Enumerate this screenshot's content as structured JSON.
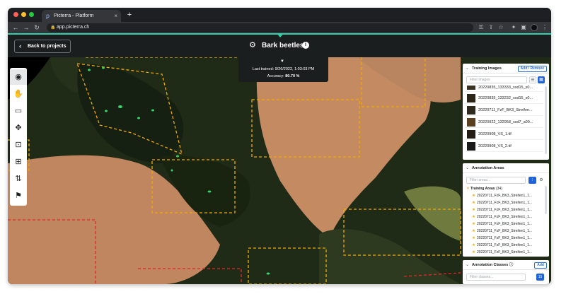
{
  "browser": {
    "tab_title": "Picterra - Platform",
    "tab_favicon": "picterra-logo-icon",
    "new_tab": "+",
    "close_tab": "×",
    "url": "app.picterra.ch",
    "nav": {
      "back": "←",
      "forward": "→",
      "reload": "↻"
    },
    "window_dots": [
      "#ff5f57",
      "#febc2e",
      "#28c840"
    ],
    "toolbar_icons": [
      "key-icon",
      "share-icon",
      "star-icon",
      "extension-icon",
      "sidebar-icon",
      "profile-avatar",
      "menu-icon"
    ]
  },
  "header": {
    "back_label": "Back to projects",
    "title": "Bark beetles",
    "accent": "#2fd1a8"
  },
  "training_status": {
    "last_trained": "Last trained: 9/26/2022, 1:03:03 PM",
    "accuracy_label": "Accuracy:",
    "accuracy_value": "80.70 %"
  },
  "tools": [
    {
      "name": "visibility",
      "icon": "eye-icon",
      "glyph": "◉"
    },
    {
      "name": "pan",
      "icon": "hand-icon",
      "glyph": "✋"
    },
    {
      "name": "rectangle",
      "icon": "rectangle-tool-icon",
      "glyph": "▭"
    },
    {
      "name": "move",
      "icon": "move-arrows-icon",
      "glyph": "✥"
    },
    {
      "name": "square-select",
      "icon": "square-select-icon",
      "glyph": "⊡"
    },
    {
      "name": "zoom-box",
      "icon": "zoom-box-icon",
      "glyph": "⊞"
    },
    {
      "name": "sort",
      "icon": "sort-arrows-icon",
      "glyph": "⇅"
    },
    {
      "name": "flag",
      "icon": "flag-icon",
      "glyph": "⚑"
    }
  ],
  "training_images": {
    "header": "Training Images",
    "add_remove": "Add / Remove",
    "filter_placeholder": "Filter images",
    "images": [
      {
        "label": "20220835_133333_ssd15_s0...",
        "thumb": "#3a3222"
      },
      {
        "label": "20220835_133232_ssd15_s0...",
        "thumb": "#2b2418"
      },
      {
        "label": "20220711_FzF_BK3_Streifen...",
        "thumb": "#2e2a20"
      },
      {
        "label": "20220922_132958_ssd7_a00...",
        "thumb": "#5a4020"
      },
      {
        "label": "20220908_VS_1.tif",
        "thumb": "#231d15"
      },
      {
        "label": "20220908_VS_2.tif",
        "thumb": "#1a1a1a"
      }
    ]
  },
  "annotation_areas": {
    "header": "Annotation Areas",
    "filter_placeholder": "Filter areas...",
    "group_label": "Training Areas",
    "group_count": "(34)",
    "items": [
      "20220711_FzF_BK3_Streifen1_1...",
      "20220711_FzF_BK3_Streifen1_1...",
      "20220711_FzF_BK3_Streifen1_1...",
      "20220711_FzF_BK3_Streifen1_1...",
      "20220711_FzF_BK3_Streifen1_1...",
      "20220711_FzF_BK3_Streifen1_1...",
      "20220711_FzF_BK3_Streifen1_1...",
      "20220711_FzF_BK3_Streifen1_1...",
      "20220711_FzF_BK3_Streifen1_1..."
    ]
  },
  "annotation_classes": {
    "header": "Annotation Classes",
    "add": "Add",
    "filter_placeholder": "Filter classes...",
    "count_badge": "15"
  },
  "colors": {
    "training_area_outline": "#f2a900",
    "testing_area_outline": "#e02828",
    "detection_fill": "#37d66a",
    "primary_button": "#1e64d8"
  }
}
